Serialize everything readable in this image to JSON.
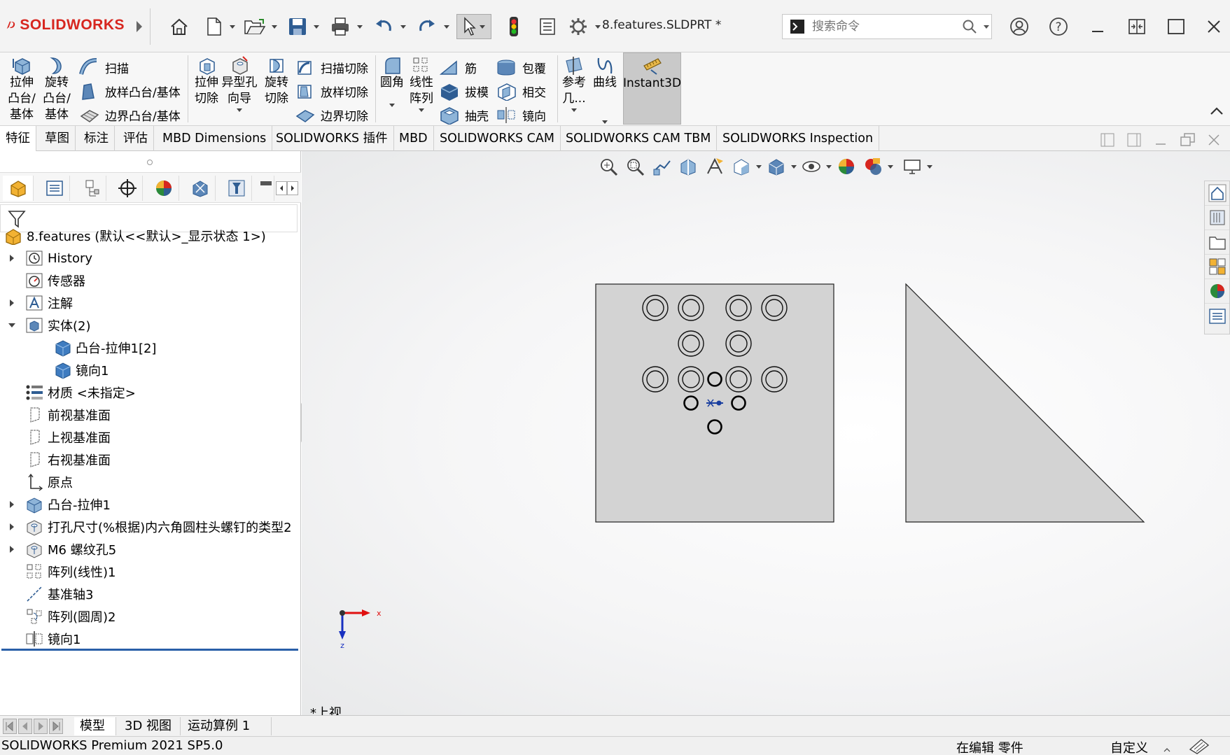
{
  "titlebar": {
    "app_name": "SOLIDWORKS",
    "document_title": "8.features.SLDPRT *",
    "search_placeholder": "搜索命令"
  },
  "ribbon": {
    "extrude_boss": "拉伸\n凸台/\n基体",
    "revolve_boss": "旋转\n凸台/\n基体",
    "sweep": "扫描",
    "loft_boss": "放样凸台/基体",
    "boundary_boss": "边界凸台/基体",
    "extrude_cut": "拉伸\n切除",
    "hole_wizard": "异型孔\n向导",
    "revolve_cut": "旋转\n切除",
    "sweep_cut": "扫描切除",
    "loft_cut": "放样切除",
    "boundary_cut": "边界切除",
    "fillet": "圆角",
    "linear_pattern": "线性\n阵列",
    "rib": "筋",
    "draft": "拔模",
    "shell": "抽壳",
    "wrap": "包覆",
    "intersect": "相交",
    "mirror": "镜向",
    "ref_geometry": "参考\n几...",
    "curves": "曲线",
    "instant3d": "Instant3D"
  },
  "tabs": [
    {
      "label": "特征"
    },
    {
      "label": "草图"
    },
    {
      "label": "标注"
    },
    {
      "label": "评估"
    },
    {
      "label": "MBD Dimensions"
    },
    {
      "label": "SOLIDWORKS 插件"
    },
    {
      "label": "MBD"
    },
    {
      "label": "SOLIDWORKS CAM"
    },
    {
      "label": "SOLIDWORKS CAM TBM"
    },
    {
      "label": "SOLIDWORKS Inspection"
    }
  ],
  "tree": {
    "root": "8.features  (默认<<默认>_显示状态 1>)",
    "items": [
      {
        "label": "History"
      },
      {
        "label": "传感器"
      },
      {
        "label": "注解"
      },
      {
        "label": "实体(2)"
      },
      {
        "label": "凸台-拉伸1[2]"
      },
      {
        "label": "镜向1"
      },
      {
        "label": "材质 <未指定>"
      },
      {
        "label": "前视基准面"
      },
      {
        "label": "上视基准面"
      },
      {
        "label": "右视基准面"
      },
      {
        "label": "原点"
      },
      {
        "label": "凸台-拉伸1"
      },
      {
        "label": "打孔尺寸(%根据)内六角圆柱头螺钉的类型2"
      },
      {
        "label": "M6 螺纹孔5"
      },
      {
        "label": "阵列(线性)1"
      },
      {
        "label": "基准轴3"
      },
      {
        "label": "阵列(圆周)2"
      },
      {
        "label": "镜向1"
      }
    ]
  },
  "viewport": {
    "view_name": "*上视",
    "axis_x": "x",
    "axis_z": "z"
  },
  "bottom_tabs": [
    {
      "label": "模型"
    },
    {
      "label": "3D 视图"
    },
    {
      "label": "运动算例 1"
    }
  ],
  "status": {
    "version": "SOLIDWORKS Premium 2021 SP5.0",
    "mode": "在编辑 零件",
    "units": "自定义"
  },
  "colors": {
    "brand_red": "#d7261f",
    "selection_blue": "#2a5fa8",
    "part_fill": "#d3d3d3"
  }
}
